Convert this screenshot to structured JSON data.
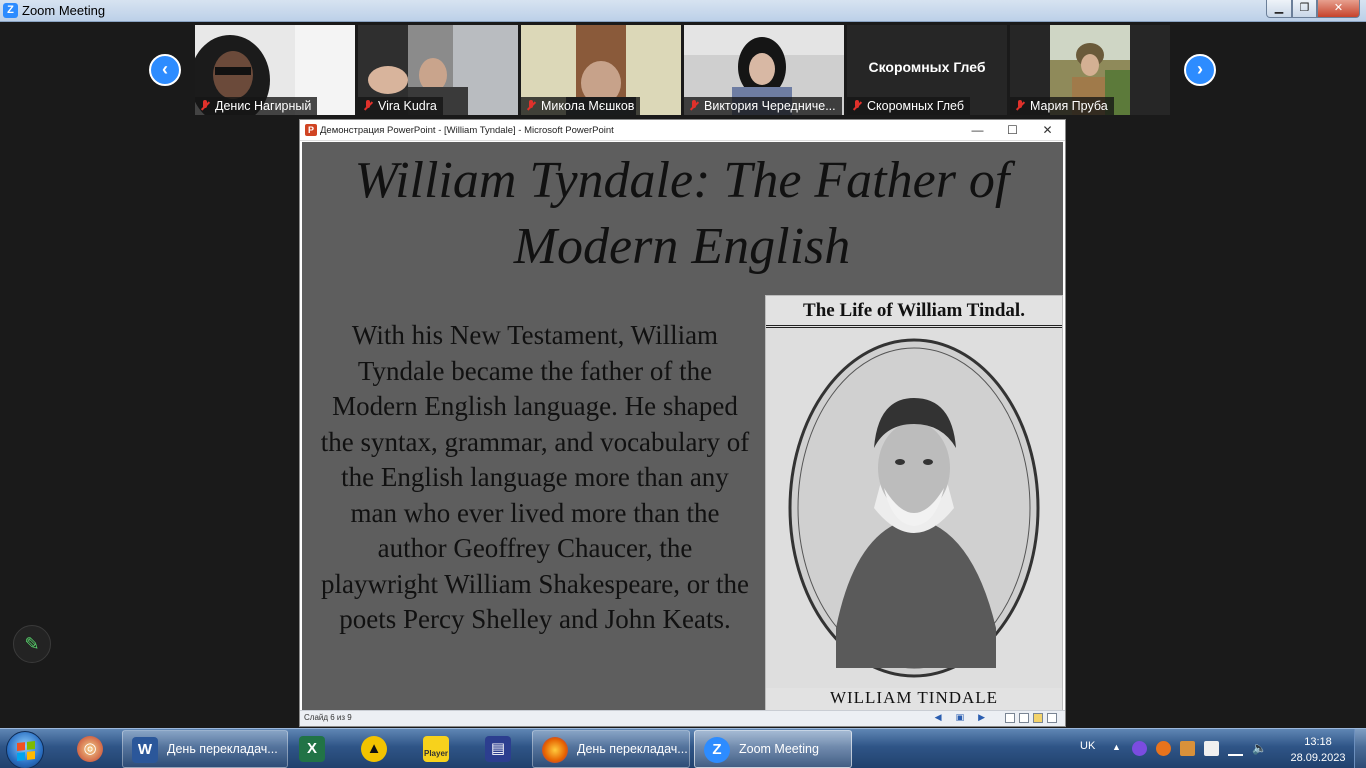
{
  "window": {
    "title": "Zoom Meeting"
  },
  "participants": [
    {
      "name": "Денис Нагирный",
      "muted": true
    },
    {
      "name": "Vira Kudra",
      "muted": true
    },
    {
      "name": "Микола Мєшков",
      "muted": true
    },
    {
      "name": "Виктория Чередниче...",
      "muted": true
    },
    {
      "name": "Скоромных Глеб",
      "muted": true,
      "video_label": "Скоромных Глеб"
    },
    {
      "name": "Мария Пруба",
      "muted": true
    }
  ],
  "ppt": {
    "window_title": "Демонстрация PowerPoint - [William Tyndale] - Microsoft PowerPoint",
    "status_slide": "Слайд 6 из 9",
    "slide": {
      "title": "William Tyndale: The Father of Modern English",
      "body": "With his New Testament, William Tyndale became the father of the Modern English language. He shaped the syntax, grammar, and vocabulary of the English language more than any man who ever lived more than the author Geoffrey Chaucer, the playwright William Shakespeare, or the poets Percy Shelley and John Keats.",
      "image_caption_top": "The Life of William Tindal.",
      "image_caption_bottom": "WILLIAM TINDALE"
    }
  },
  "taskbar": {
    "items": [
      {
        "label": "День перекладач...",
        "app": "word"
      },
      {
        "label": "",
        "app": "excel"
      },
      {
        "label": "",
        "app": "archicad"
      },
      {
        "label": "Player",
        "app": "player"
      },
      {
        "label": "",
        "app": "save"
      },
      {
        "label": "День перекладач...",
        "app": "firefox"
      },
      {
        "label": "Zoom Meeting",
        "app": "zoom"
      }
    ],
    "language": "UK",
    "time": "13:18",
    "date": "28.09.2023"
  },
  "colors": {
    "zoom_blue": "#2d8cff",
    "muted_red": "#e0312b",
    "slide_bg": "#5e5e5e"
  }
}
